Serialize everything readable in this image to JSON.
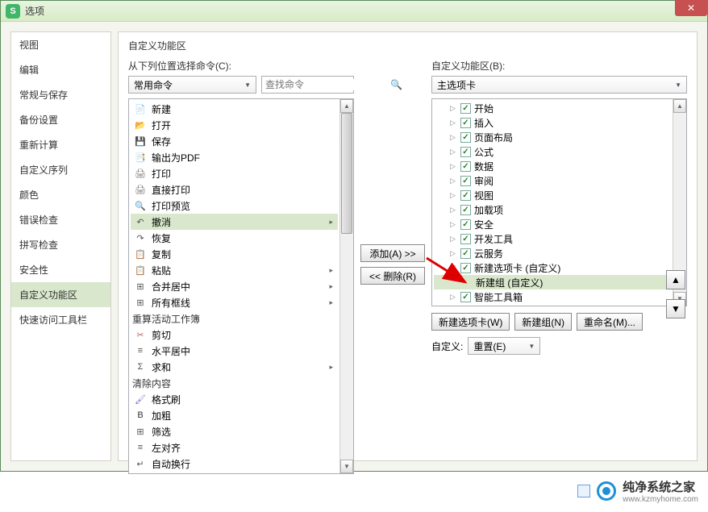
{
  "window": {
    "title": "选项"
  },
  "close_glyph": "✕",
  "sidebar": {
    "items": [
      {
        "label": "视图"
      },
      {
        "label": "编辑"
      },
      {
        "label": "常规与保存"
      },
      {
        "label": "备份设置"
      },
      {
        "label": "重新计算"
      },
      {
        "label": "自定义序列"
      },
      {
        "label": "颜色"
      },
      {
        "label": "错误检查"
      },
      {
        "label": "拼写检查"
      },
      {
        "label": "安全性"
      },
      {
        "label": "自定义功能区"
      },
      {
        "label": "快速访问工具栏"
      }
    ],
    "active_index": 10
  },
  "panel": {
    "title": "自定义功能区"
  },
  "left": {
    "label": "从下列位置选择命令(C):",
    "select_value": "常用命令",
    "search_placeholder": "查找命令",
    "groups": [
      {
        "header": null,
        "items": [
          {
            "icon": "📄",
            "color": "#4a90c0",
            "label": "新建"
          },
          {
            "icon": "📂",
            "color": "#e6a83c",
            "label": "打开"
          },
          {
            "icon": "💾",
            "color": "#5a88b0",
            "label": "保存"
          },
          {
            "icon": "📑",
            "color": "#c06040",
            "label": "输出为PDF"
          },
          {
            "icon": "🖨",
            "color": "#777",
            "label": "打印"
          },
          {
            "icon": "🖨",
            "color": "#777",
            "label": "直接打印"
          },
          {
            "icon": "🔍",
            "color": "#777",
            "label": "打印预览"
          },
          {
            "icon": "↶",
            "color": "#555",
            "label": "撤消",
            "selected": true,
            "sub": true
          },
          {
            "icon": "↷",
            "color": "#555",
            "label": "恢复"
          },
          {
            "icon": "📋",
            "color": "#6a9a48",
            "label": "复制"
          },
          {
            "icon": "📋",
            "color": "#6a9a48",
            "label": "粘贴",
            "sub": true
          },
          {
            "icon": "⊞",
            "color": "#555",
            "label": "合并居中",
            "sub": true
          },
          {
            "icon": "⊞",
            "color": "#555",
            "label": "所有框线",
            "sub": true
          }
        ]
      },
      {
        "header": "重算活动工作簿",
        "items": [
          {
            "icon": "✂",
            "color": "#c06060",
            "label": "剪切"
          },
          {
            "icon": "≡",
            "color": "#555",
            "label": "水平居中"
          },
          {
            "icon": "Σ",
            "color": "#555",
            "label": "求和",
            "sub": true
          }
        ]
      },
      {
        "header": "清除内容",
        "items": [
          {
            "icon": "🖌",
            "color": "#8070c0",
            "label": "格式刷"
          },
          {
            "icon": "B",
            "color": "#333",
            "label": "加粗"
          },
          {
            "icon": "⊞",
            "color": "#555",
            "label": "筛选"
          },
          {
            "icon": "≡",
            "color": "#555",
            "label": "左对齐"
          },
          {
            "icon": "↵",
            "color": "#555",
            "label": "自动换行"
          }
        ]
      }
    ]
  },
  "mid": {
    "add_label": "添加(A) >>",
    "remove_label": "<< 删除(R)"
  },
  "right": {
    "label": "自定义功能区(B):",
    "select_value": "主选项卡",
    "tree": [
      {
        "label": "开始",
        "checked": true
      },
      {
        "label": "插入",
        "checked": true
      },
      {
        "label": "页面布局",
        "checked": true
      },
      {
        "label": "公式",
        "checked": true
      },
      {
        "label": "数据",
        "checked": true
      },
      {
        "label": "审阅",
        "checked": true
      },
      {
        "label": "视图",
        "checked": true
      },
      {
        "label": "加载项",
        "checked": true
      },
      {
        "label": "安全",
        "checked": true
      },
      {
        "label": "开发工具",
        "checked": true
      },
      {
        "label": "云服务",
        "checked": true
      },
      {
        "label": "新建选项卡 (自定义)",
        "checked": true,
        "expanded": true,
        "children": [
          {
            "label": "新建组 (自定义)",
            "selected": true
          }
        ]
      },
      {
        "label": "智能工具箱",
        "checked": true
      }
    ],
    "buttons": {
      "new_tab": "新建选项卡(W)",
      "new_group": "新建组(N)",
      "rename": "重命名(M)..."
    },
    "customize_label": "自定义:",
    "reset_label": "重置(E)",
    "up_glyph": "▲",
    "down_glyph": "▼"
  },
  "watermark": {
    "text": "纯净系统之家",
    "url": "www.kzmyhome.com"
  }
}
